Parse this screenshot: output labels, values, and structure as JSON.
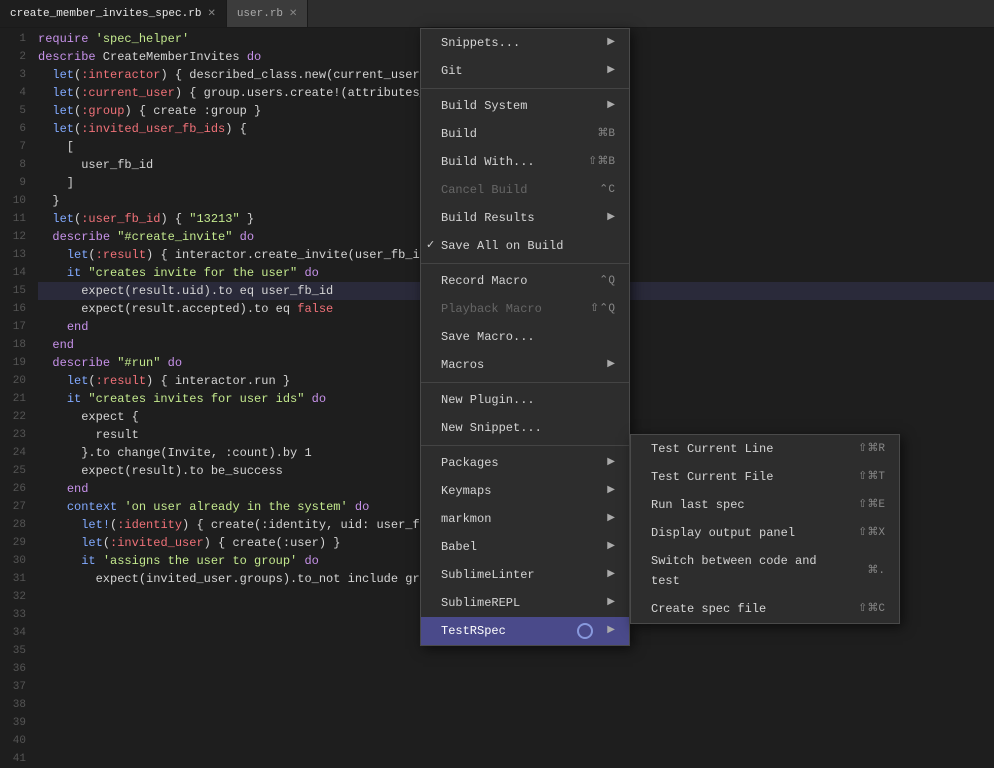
{
  "tabs": [
    {
      "id": "create_member_invites_spec",
      "label": "create_member_invites_spec.rb",
      "active": true
    },
    {
      "id": "user_rb",
      "label": "user.rb",
      "active": false
    }
  ],
  "code_lines": [
    {
      "num": 1,
      "text": "require 'spec_helper'",
      "tokens": [
        {
          "t": "kw",
          "v": "require"
        },
        {
          "t": "",
          "v": " "
        },
        {
          "t": "str",
          "v": "'spec_helper'"
        }
      ]
    },
    {
      "num": 2,
      "text": ""
    },
    {
      "num": 3,
      "text": "describe CreateMemberInvites do",
      "tokens": [
        {
          "t": "kw",
          "v": "describe"
        },
        {
          "t": "",
          "v": " CreateMemberInvites "
        },
        {
          "t": "kw",
          "v": "do"
        }
      ]
    },
    {
      "num": 4,
      "text": "  let(:interactor) { described_class.new(current_user,",
      "tokens": [
        {
          "t": "",
          "v": "  "
        },
        {
          "t": "fn",
          "v": "let"
        },
        {
          "t": "",
          "v": "("
        },
        {
          "t": "sym",
          "v": ":interactor"
        },
        {
          "t": "",
          "v": ")"
        },
        {
          "t": "",
          "v": " { described_class.new(current_user,"
        }
      ]
    },
    {
      "num": 5,
      "text": "  let(:current_user) { group.users.create!(attributes_",
      "tokens": [
        {
          "t": "",
          "v": "  "
        },
        {
          "t": "fn",
          "v": "let"
        },
        {
          "t": "",
          "v": "("
        },
        {
          "t": "sym",
          "v": ":current_user"
        },
        {
          "t": "",
          "v": ")"
        },
        {
          "t": "",
          "v": " { group.users.create!(attributes_"
        }
      ]
    },
    {
      "num": 6,
      "text": "  let(:group) { create :group }",
      "tokens": [
        {
          "t": "",
          "v": "  "
        },
        {
          "t": "fn",
          "v": "let"
        },
        {
          "t": "",
          "v": "("
        },
        {
          "t": "sym",
          "v": ":group"
        },
        {
          "t": "",
          "v": ")"
        },
        {
          "t": "",
          "v": " { create :group }"
        }
      ]
    },
    {
      "num": 7,
      "text": "  let(:invited_user_fb_ids) {",
      "tokens": [
        {
          "t": "",
          "v": "  "
        },
        {
          "t": "fn",
          "v": "let"
        },
        {
          "t": "",
          "v": "("
        },
        {
          "t": "sym",
          "v": ":invited_user_fb_ids"
        },
        {
          "t": "",
          "v": ")"
        },
        {
          "t": "",
          "v": " {"
        }
      ]
    },
    {
      "num": 8,
      "text": "    [",
      "tokens": [
        {
          "t": "",
          "v": "    ["
        }
      ]
    },
    {
      "num": 9,
      "text": "      user_fb_id",
      "tokens": [
        {
          "t": "",
          "v": "      user_fb_id"
        }
      ]
    },
    {
      "num": 10,
      "text": "    ]",
      "tokens": [
        {
          "t": "",
          "v": "    ]"
        }
      ]
    },
    {
      "num": 11,
      "text": "  }",
      "tokens": [
        {
          "t": "",
          "v": "  }"
        }
      ]
    },
    {
      "num": 12,
      "text": ""
    },
    {
      "num": 13,
      "text": "  let(:user_fb_id) { \"13213\" }",
      "tokens": [
        {
          "t": "",
          "v": "  "
        },
        {
          "t": "fn",
          "v": "let"
        },
        {
          "t": "",
          "v": "("
        },
        {
          "t": "sym",
          "v": ":user_fb_id"
        },
        {
          "t": "",
          "v": ")"
        },
        {
          "t": "",
          "v": " { "
        },
        {
          "t": "str",
          "v": "\"13213\""
        },
        {
          "t": "",
          "v": " }"
        }
      ]
    },
    {
      "num": 14,
      "text": ""
    },
    {
      "num": 15,
      "text": "  describe \"#create_invite\" do",
      "tokens": [
        {
          "t": "",
          "v": "  "
        },
        {
          "t": "kw",
          "v": "describe"
        },
        {
          "t": "",
          "v": " "
        },
        {
          "t": "str",
          "v": "\"#create_invite\""
        },
        {
          "t": "",
          "v": " "
        },
        {
          "t": "kw",
          "v": "do"
        }
      ]
    },
    {
      "num": 16,
      "text": "    let(:result) { interactor.create_invite(user_fb_id:",
      "tokens": [
        {
          "t": "",
          "v": "    "
        },
        {
          "t": "fn",
          "v": "let"
        },
        {
          "t": "",
          "v": "("
        },
        {
          "t": "sym",
          "v": ":result"
        },
        {
          "t": "",
          "v": ")"
        },
        {
          "t": "",
          "v": " { interactor.create_invite(user_fb_id:"
        }
      ]
    },
    {
      "num": 17,
      "text": ""
    },
    {
      "num": 18,
      "text": "    it \"creates invite for the user\" do",
      "tokens": [
        {
          "t": "",
          "v": "    "
        },
        {
          "t": "fn",
          "v": "it"
        },
        {
          "t": "",
          "v": " "
        },
        {
          "t": "str",
          "v": "\"creates invite for the user\""
        },
        {
          "t": "",
          "v": " "
        },
        {
          "t": "kw",
          "v": "do"
        }
      ]
    },
    {
      "num": 19,
      "text": "      expect(result.uid).to eq user_fb_id",
      "tokens": [
        {
          "t": "",
          "v": "      expect(result.uid).to eq user_fb_id"
        }
      ],
      "highlighted": true
    },
    {
      "num": 20,
      "text": "      expect(result.accepted).to eq false",
      "tokens": [
        {
          "t": "",
          "v": "      expect(result.accepted).to eq "
        },
        {
          "t": "bool-false",
          "v": "false"
        }
      ]
    },
    {
      "num": 21,
      "text": "    end",
      "tokens": [
        {
          "t": "",
          "v": "    "
        },
        {
          "t": "kw",
          "v": "end"
        }
      ]
    },
    {
      "num": 22,
      "text": "  end",
      "tokens": [
        {
          "t": "",
          "v": "  "
        },
        {
          "t": "kw",
          "v": "end"
        }
      ]
    },
    {
      "num": 23,
      "text": ""
    },
    {
      "num": 24,
      "text": "  describe \"#run\" do",
      "tokens": [
        {
          "t": "",
          "v": "  "
        },
        {
          "t": "kw",
          "v": "describe"
        },
        {
          "t": "",
          "v": " "
        },
        {
          "t": "str",
          "v": "\"#run\""
        },
        {
          "t": "",
          "v": " "
        },
        {
          "t": "kw",
          "v": "do"
        }
      ]
    },
    {
      "num": 25,
      "text": "    let(:result) { interactor.run }",
      "tokens": [
        {
          "t": "",
          "v": "    "
        },
        {
          "t": "fn",
          "v": "let"
        },
        {
          "t": "",
          "v": "("
        },
        {
          "t": "sym",
          "v": ":result"
        },
        {
          "t": "",
          "v": ")"
        },
        {
          "t": "",
          "v": " { interactor.run }"
        }
      ]
    },
    {
      "num": 26,
      "text": ""
    },
    {
      "num": 27,
      "text": "    it \"creates invites for user ids\" do",
      "tokens": [
        {
          "t": "",
          "v": "    "
        },
        {
          "t": "fn",
          "v": "it"
        },
        {
          "t": "",
          "v": " "
        },
        {
          "t": "str",
          "v": "\"creates invites for user ids\""
        },
        {
          "t": "",
          "v": " "
        },
        {
          "t": "kw",
          "v": "do"
        }
      ]
    },
    {
      "num": 28,
      "text": "      expect {",
      "tokens": [
        {
          "t": "",
          "v": "      expect {"
        }
      ]
    },
    {
      "num": 29,
      "text": "        result",
      "tokens": [
        {
          "t": "",
          "v": "        result"
        }
      ]
    },
    {
      "num": 30,
      "text": "      }.to change(Invite, :count).by 1",
      "tokens": [
        {
          "t": "",
          "v": "      }.to change(Invite, :count).by 1"
        }
      ]
    },
    {
      "num": 31,
      "text": ""
    },
    {
      "num": 32,
      "text": "      expect(result).to be_success",
      "tokens": [
        {
          "t": "",
          "v": "      expect(result).to be_success"
        }
      ]
    },
    {
      "num": 33,
      "text": "    end",
      "tokens": [
        {
          "t": "",
          "v": "    "
        },
        {
          "t": "kw",
          "v": "end"
        }
      ]
    },
    {
      "num": 34,
      "text": ""
    },
    {
      "num": 35,
      "text": "    context 'on user already in the system' do",
      "tokens": [
        {
          "t": "",
          "v": "    "
        },
        {
          "t": "fn",
          "v": "context"
        },
        {
          "t": "",
          "v": " "
        },
        {
          "t": "str",
          "v": "'on user already in the system'"
        },
        {
          "t": "",
          "v": " "
        },
        {
          "t": "kw",
          "v": "do"
        }
      ]
    },
    {
      "num": 36,
      "text": "      let!(:identity) { create(:identity, uid: user_fb_id, user: invited_user) }",
      "tokens": [
        {
          "t": "",
          "v": "      "
        },
        {
          "t": "fn",
          "v": "let!"
        },
        {
          "t": "",
          "v": "("
        },
        {
          "t": "sym",
          "v": ":identity"
        },
        {
          "t": "",
          "v": ")"
        },
        {
          "t": "",
          "v": " { create(:identity, uid: user_fb_id, user: invited_user) }"
        }
      ]
    },
    {
      "num": 37,
      "text": "      let(:invited_user) { create(:user) }",
      "tokens": [
        {
          "t": "",
          "v": "      "
        },
        {
          "t": "fn",
          "v": "let"
        },
        {
          "t": "",
          "v": "("
        },
        {
          "t": "sym",
          "v": ":invited_user"
        },
        {
          "t": "",
          "v": ")"
        },
        {
          "t": "",
          "v": " { create(:user) }"
        }
      ]
    },
    {
      "num": 38,
      "text": ""
    },
    {
      "num": 39,
      "text": "      it 'assigns the user to group' do",
      "tokens": [
        {
          "t": "",
          "v": "      "
        },
        {
          "t": "fn",
          "v": "it"
        },
        {
          "t": "",
          "v": " "
        },
        {
          "t": "str",
          "v": "'assigns the user to group'"
        },
        {
          "t": "",
          "v": " "
        },
        {
          "t": "kw",
          "v": "do"
        }
      ]
    },
    {
      "num": 40,
      "text": "        expect(invited_user.groups).to_not include group",
      "tokens": [
        {
          "t": "",
          "v": "        expect(invited_user.groups).to_not include group"
        }
      ]
    },
    {
      "num": 41,
      "text": "          result",
      "tokens": [
        {
          "t": "",
          "v": "          result"
        }
      ]
    }
  ],
  "main_menu": {
    "items": [
      {
        "id": "snippets",
        "label": "Snippets...",
        "has_arrow": true,
        "shortcut": ""
      },
      {
        "id": "git",
        "label": "Git",
        "has_arrow": true,
        "shortcut": ""
      },
      {
        "id": "sep1",
        "separator": true
      },
      {
        "id": "build_system",
        "label": "Build System",
        "has_arrow": true,
        "shortcut": ""
      },
      {
        "id": "build",
        "label": "Build",
        "has_arrow": false,
        "shortcut": "⌘B"
      },
      {
        "id": "build_with",
        "label": "Build With...",
        "has_arrow": false,
        "shortcut": "⇧⌘B"
      },
      {
        "id": "cancel_build",
        "label": "Cancel Build",
        "has_arrow": false,
        "shortcut": "⌃C",
        "disabled": true
      },
      {
        "id": "build_results",
        "label": "Build Results",
        "has_arrow": true,
        "shortcut": ""
      },
      {
        "id": "save_all_on_build",
        "label": "Save All on Build",
        "has_arrow": false,
        "shortcut": "",
        "checked": true
      },
      {
        "id": "sep2",
        "separator": true
      },
      {
        "id": "record_macro",
        "label": "Record Macro",
        "has_arrow": false,
        "shortcut": "⌃Q"
      },
      {
        "id": "playback_macro",
        "label": "Playback Macro",
        "has_arrow": false,
        "shortcut": "⇧⌃Q",
        "disabled": true
      },
      {
        "id": "save_macro",
        "label": "Save Macro...",
        "has_arrow": false,
        "shortcut": ""
      },
      {
        "id": "macros",
        "label": "Macros",
        "has_arrow": true,
        "shortcut": ""
      },
      {
        "id": "sep3",
        "separator": true
      },
      {
        "id": "new_plugin",
        "label": "New Plugin...",
        "has_arrow": false,
        "shortcut": ""
      },
      {
        "id": "new_snippet",
        "label": "New Snippet...",
        "has_arrow": false,
        "shortcut": ""
      },
      {
        "id": "sep4",
        "separator": true
      },
      {
        "id": "packages",
        "label": "Packages",
        "has_arrow": true,
        "shortcut": ""
      },
      {
        "id": "keymaps",
        "label": "Keymaps",
        "has_arrow": true,
        "shortcut": ""
      },
      {
        "id": "markmon",
        "label": "markmon",
        "has_arrow": true,
        "shortcut": ""
      },
      {
        "id": "babel",
        "label": "Babel",
        "has_arrow": true,
        "shortcut": ""
      },
      {
        "id": "sublime_linter",
        "label": "SublimeLinter",
        "has_arrow": true,
        "shortcut": ""
      },
      {
        "id": "sublime_repl",
        "label": "SublimeREPL",
        "has_arrow": true,
        "shortcut": ""
      },
      {
        "id": "test_rspec",
        "label": "TestRSpec",
        "has_arrow": true,
        "shortcut": "",
        "hovered": true
      }
    ]
  },
  "submenu": {
    "items": [
      {
        "id": "test_current_line",
        "label": "Test Current Line",
        "shortcut": "⇧⌘R"
      },
      {
        "id": "test_current_file",
        "label": "Test Current File",
        "shortcut": "⇧⌘T"
      },
      {
        "id": "run_last_spec",
        "label": "Run last spec",
        "shortcut": "⇧⌘E"
      },
      {
        "id": "display_output_panel",
        "label": "Display output panel",
        "shortcut": "⇧⌘X"
      },
      {
        "id": "switch_between",
        "label": "Switch between code and test",
        "shortcut": "⌘."
      },
      {
        "id": "create_spec_file",
        "label": "Create spec file",
        "shortcut": "⇧⌘C"
      }
    ]
  }
}
